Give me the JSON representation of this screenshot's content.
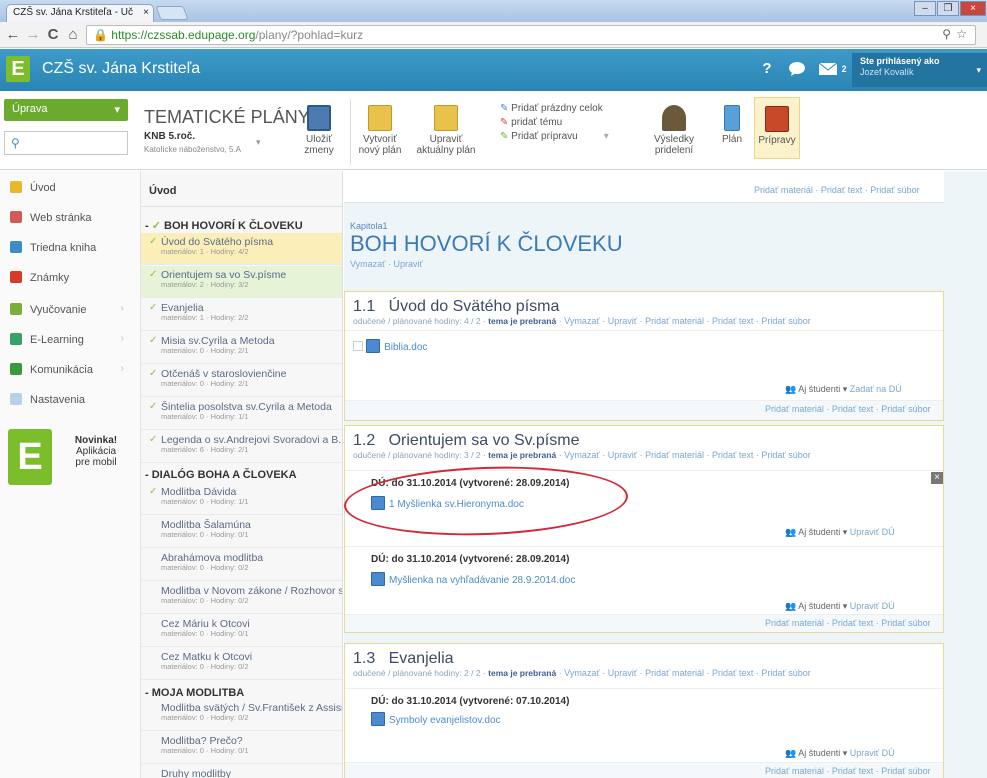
{
  "browser": {
    "tab_title": "CZŠ sv. Jána Krstiteľa - Uč",
    "tab_close": "×",
    "url_host": "https://czssab.edupage.org",
    "url_path": "/plany/?pohlad=kurz",
    "win_min": "–",
    "win_max": "❐",
    "win_close": "×",
    "back": "←",
    "forward": "→",
    "reload": "C",
    "home": "⌂",
    "search": "⚲",
    "star": "☆",
    "menu": "≡"
  },
  "header": {
    "logo": "E",
    "school": "CZŠ sv. Jána Krstiteľa",
    "help": "?",
    "chat_icon": "chat-icon",
    "mail_count": "2",
    "user_status": "Ste prihlásený ako",
    "user_name": "Jozef Kovalík"
  },
  "sidebar": {
    "uprava": "Úprava",
    "uprava_arrow": "▾",
    "search_icon": "⚲",
    "items": [
      {
        "label": "Úvod",
        "color": "#e8b928"
      },
      {
        "label": "Web stránka",
        "color": "#d45a5a"
      },
      {
        "label": "Triedna kniha",
        "color": "#3d8cc8"
      },
      {
        "label": "Známky",
        "color": "#d53a2a"
      },
      {
        "label": "Vyučovanie",
        "color": "#7ab03a"
      },
      {
        "label": "E-Learning",
        "color": "#3aa06a"
      },
      {
        "label": "Komunikácia",
        "color": "#3a9a3a"
      },
      {
        "label": "Nastavenia",
        "color": "#b8d0e8"
      }
    ],
    "arrow": "›",
    "novinka": {
      "logo": "E",
      "line1": "Novinka!",
      "line2": "Aplikácia",
      "line3": "pre mobil"
    }
  },
  "toolbar": {
    "title": "TEMATICKÉ PLÁNY",
    "subject": "KNB 5.roč.",
    "subject_detail": "Katolícke náboženstvo, 5.A",
    "dropdown": "▾",
    "save": [
      "Uložiť",
      "zmeny"
    ],
    "new_plan": [
      "Vytvoriť",
      "nový plán"
    ],
    "edit_plan": [
      "Upraviť",
      "aktuálny plán"
    ],
    "list": [
      "Pridať prázdny celok",
      "pridať tému",
      "Pridať prípravu"
    ],
    "results": [
      "Výsledky",
      "pridelení"
    ],
    "plan": "Plán",
    "prep": "Prípravy"
  },
  "outline": {
    "intro": "Úvod",
    "collapse": "-",
    "check": "✓",
    "groups": [
      {
        "title": "BOH HOVORÍ K ČLOVEKU",
        "items": [
          {
            "t": "Úvod do Svätého písma",
            "m": "materiálov: 1 · Hodiny: 4/2",
            "sel": "yellow",
            "ck": true
          },
          {
            "t": "Orientujem sa vo Sv.písme",
            "m": "materiálov: 2 · Hodiny: 3/2",
            "sel": "green",
            "ck": true
          },
          {
            "t": "Evanjelia",
            "m": "materiálov: 1 · Hodiny: 2/2",
            "ck": true
          },
          {
            "t": "Misia sv.Cyrila a Metoda",
            "m": "materiálov: 0 · Hodiny: 2/1",
            "ck": true
          },
          {
            "t": "Otčenáš v staroslovienčine",
            "m": "materiálov: 0 · Hodiny: 2/1",
            "ck": true
          },
          {
            "t": "Šintelia posolstva sv.Cyrila a Metoda",
            "m": "materiálov: 0 · Hodiny: 1/1",
            "ck": true
          },
          {
            "t": "Legenda o sv.Andrejovi Svoradovi a B...",
            "m": "materiálov: 6 · Hodiny: 2/1",
            "ck": true
          }
        ]
      },
      {
        "title": "DIALÓG BOHA A ČLOVEKA",
        "items": [
          {
            "t": "Modlitba Dávida",
            "m": "materiálov: 0 · Hodiny: 1/1",
            "ck": true
          },
          {
            "t": "Modlitba Šalamúna",
            "m": "materiálov: 0 · Hodiny: 0/1"
          },
          {
            "t": "Abrahámova modlitba",
            "m": "materiálov: 0 · Hodiny: 0/2"
          },
          {
            "t": "Modlitba v Novom zákone / Rozhovor s ...",
            "m": "materiálov: 0 · Hodiny: 0/2"
          },
          {
            "t": "Cez Máriu k Otcovi",
            "m": "materiálov: 0 · Hodiny: 0/1"
          },
          {
            "t": "Cez Matku k Otcovi",
            "m": "materiálov: 0 · Hodiny: 0/2"
          }
        ]
      },
      {
        "title": "MOJA MODLITBA",
        "items": [
          {
            "t": "Modlitba svätých / Sv.František z Assisi",
            "m": "materiálov: 0 · Hodiny: 0/2"
          },
          {
            "t": "Modlitba? Prečo?",
            "m": "materiálov: 0 · Hodiny: 0/1"
          },
          {
            "t": "Druhy modlitby",
            "m": "materiálov: 0 · Hodiny: 0/2"
          }
        ]
      }
    ]
  },
  "main": {
    "top_links": "Pridať materiál · Pridať text · Pridať súbor",
    "chapter_label": "Kapitola1",
    "chapter_title": "BOH HOVORÍ K ČLOVEKU",
    "chapter_actions": "Vymazať · Upraviť",
    "sections": [
      {
        "num": "1.1",
        "title": "Úvod do Svätého písma",
        "meta_pre": "odučené / plánované hodiny: 4 / 2 · ",
        "meta_b": "tema je prebraná",
        "meta_post": " · Vymazať · Upraviť · Pridať materiál · Pridať text · Pridať súbor",
        "file": "Biblia.doc",
        "students": "Aj študenti",
        "zadat": "Zadať na DÚ",
        "footer": "Pridať materiál · Pridať text · Pridať súbor"
      },
      {
        "num": "1.2",
        "title": "Orientujem sa vo Sv.písme",
        "meta_pre": "odučené / plánované hodiny: 3 / 2 · ",
        "meta_b": "tema je prebraná",
        "meta_post": " · Vymazať · Upraviť · Pridať materiál · Pridať text · Pridať súbor",
        "du1": "DÚ: do 31.10.2014 (vytvorené: 28.09.2014)",
        "file1": "1 Myšlienka sv.Hieronyma.doc",
        "students": "Aj študenti",
        "upravit_du": "Upraviť DÚ",
        "du2": "DÚ: do 31.10.2014 (vytvorené: 28.09.2014)",
        "file2": "Myšlienka na vyhľadávanie 28.9.2014.doc",
        "footer": "Pridať materiál · Pridať text · Pridať súbor",
        "close": "×"
      },
      {
        "num": "1.3",
        "title": "Evanjelia",
        "meta_pre": "odučené / plánované hodiny: 2 / 2 · ",
        "meta_b": "tema je prebraná",
        "meta_post": " · Vymazať · Upraviť · Pridať materiál · Pridať text · Pridať súbor",
        "du1": "DÚ: do 31.10.2014 (vytvorené: 07.10.2014)",
        "file1": "Symboly evanjelistov.doc",
        "students": "Aj študenti",
        "upravit_du": "Upraviť DÚ",
        "footer": "Pridať materiál · Pridať text · Pridať súbor"
      }
    ]
  }
}
